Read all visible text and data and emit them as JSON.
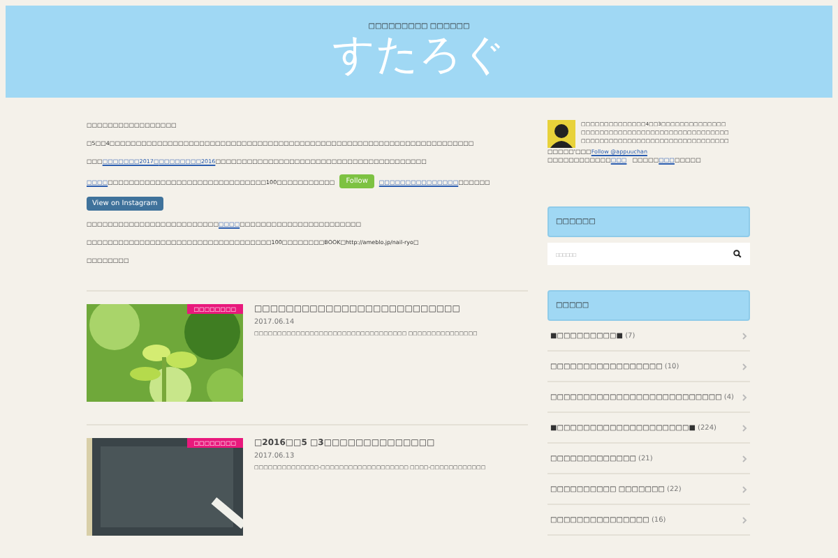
{
  "header": {
    "tagline": "□□□□□□□□□ □□□□□□",
    "title": "すたろぐ"
  },
  "intro": [
    {
      "segments": [
        {
          "text": "□□□□□□□□□□□□□□□□□",
          "link": false
        }
      ]
    },
    {
      "segments": [
        {
          "text": "□5□□4□□□□□□□□□□□□□□□□□□□□□□□□□□□□□□□□□□□□□□□□□□□□□□□□□□□□□□□□□□□□□□□□□□□□□",
          "link": false
        }
      ]
    },
    {
      "segments": [
        {
          "text": "□□□",
          "link": false
        },
        {
          "text": "□□□□□□□2017□",
          "link": true
        },
        {
          "text": "□□□□□□□□2016",
          "link": true
        },
        {
          "text": "□□□□□□□□□□□□□□□□□□□□□□□□□□□□□□□□□□□□□□□□",
          "link": false
        }
      ]
    },
    {
      "segments": [
        {
          "text": "□□□□",
          "link": true
        },
        {
          "text": "□□□□□□□□□□□□□□□□□□□□□□□□□□□□□□100□□□□□□□□□□□",
          "link": false
        },
        {
          "text": "Follow",
          "kind": "follow"
        },
        {
          "text": "□□□□□□□□□□□□□□□",
          "link": true
        },
        {
          "text": "□□□□□□",
          "link": false
        }
      ]
    },
    {
      "segments": [
        {
          "text": "View on Instagram",
          "kind": "instagram"
        }
      ]
    },
    {
      "segments": [
        {
          "text": "□□□□□□□□□□□□□□□□□□□□□□□□□",
          "link": false
        },
        {
          "text": "□□□□",
          "link": true
        },
        {
          "text": "□□□□□□□□□□□□□□□□□□□□□□□",
          "link": false
        }
      ]
    },
    {
      "segments": [
        {
          "text": "□□□□□□□□□□□□□□□□□□□□□□□□□□□□□□□□□□□100□□□□□□□□BOOK□http://ameblo.jp/nail-ryo□",
          "link": false
        }
      ]
    },
    {
      "segments": [
        {
          "text": "□□□□□□□□",
          "link": false
        }
      ]
    }
  ],
  "posts": [
    {
      "category": "□□□□□□□□",
      "title": "□□□□□□□□□□□□□□□□□□□□□□□□□□",
      "date": "2017.06.14",
      "excerpt": "□□□□□□□□□□□□□□□□□□□□□□□□□□□□□□□□□ □□□□□□□□□□□□□□□"
    },
    {
      "category": "□□□□□□□□",
      "title": "□2016□□5 □3□□□□□□□□□□□□□□",
      "date": "2017.06.13",
      "excerpt": "□□□□□□□□□□□□□□-□□□□□□□□□□□□□□□□□□□ □□□□-□□□□□□□□□□□□"
    }
  ],
  "profile": {
    "lines": [
      "□□□□□□□□□□□□□□4□□3□□□□□□□□□□□□□□",
      "□□□□□□□□□□□□□□□□□□□□□□□□□□□□□□□□",
      "□□□□□□□□□□□□□□□□□□□□□□□□□□□□□□□□"
    ],
    "handle_prefix": "□□□□□'□□□",
    "follow": "Follow @appuuchan",
    "links_line": [
      {
        "text": "□□□□□□□□□□□□",
        "link": false
      },
      {
        "text": "□□□",
        "link": true
      },
      {
        "text": "　□□□□□",
        "link": false
      },
      {
        "text": "□□□",
        "link": true
      },
      {
        "text": "□□□□□",
        "link": false
      }
    ]
  },
  "search_widget": {
    "heading": "□□□□□□",
    "placeholder": "□□□□□□"
  },
  "categories_widget": {
    "heading": "□□□□□",
    "items": [
      {
        "name": "■□□□□□□□□□■",
        "count": "(7)"
      },
      {
        "name": "□□□□□□□□□□□□□□□□□",
        "count": "(10)"
      },
      {
        "name": "□□□□□□□□□□□□□□□□□□□□□□□□□□",
        "count": "(4)"
      },
      {
        "name": "■□□□□□□□□□□□□□□□□□□□□■",
        "count": "(224)"
      },
      {
        "name": "□□□□□□□□□□□□□",
        "count": "(21)"
      },
      {
        "name": "□□□□□□□□□□ □□□□□□□",
        "count": "(22)"
      },
      {
        "name": "□□□□□□□□□□□□□□□",
        "count": "(16)"
      }
    ]
  }
}
